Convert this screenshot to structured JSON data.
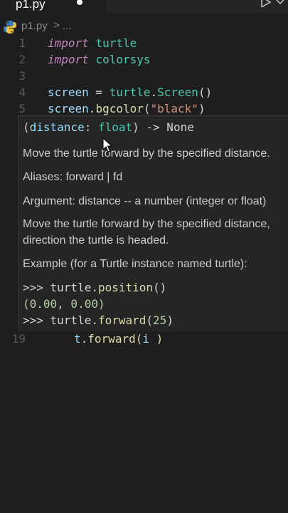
{
  "tab": {
    "filename": "p1.py"
  },
  "breadcrumb": {
    "file": "p1.py",
    "separator": ">",
    "more": "..."
  },
  "lines": [
    {
      "num": "1",
      "t1": "import",
      "t2": " ",
      "t3": "turtle"
    },
    {
      "num": "2",
      "t1": "import",
      "t2": " ",
      "t3": "colorsys"
    },
    {
      "num": "3"
    },
    {
      "num": "4",
      "screen": "screen",
      "eq": " = ",
      "mod": "turtle",
      "dot": ".",
      "fn": "Screen",
      "paren": "()"
    },
    {
      "num": "5",
      "screen": "screen",
      "dot": ".",
      "fn": "bgcolor",
      "open": "(",
      "str": "\"black\"",
      "close": ")"
    }
  ],
  "line19": {
    "num": "19",
    "obj": "t",
    "dot": ".",
    "fn": "forward",
    "open": "(",
    "arg": "i",
    "close": " )"
  },
  "hover": {
    "sig_open": "(",
    "sig_param": "distance",
    "sig_colon": ": ",
    "sig_type": "float",
    "sig_rest": ") -> None",
    "desc1": "Move the turtle forward by the specified distance.",
    "aliases": "Aliases: forward | fd",
    "argument": "Argument: distance -- a number (integer or float)",
    "desc2a": "Move the turtle forward by the specified distance,",
    "desc2b": "direction the turtle is headed.",
    "example": "Example (for a Turtle instance named turtle):",
    "ex1_prompt": ">>> ",
    "ex1_obj": "turtle",
    "ex1_dot": ".",
    "ex1_fn": "position",
    "ex1_paren": "()",
    "ex2": "(0.00, 0.00)",
    "ex3_prompt": ">>> ",
    "ex3_obj": "turtle",
    "ex3_dot": ".",
    "ex3_fn": "forward",
    "ex3_open": "(",
    "ex3_num": "25",
    "ex3_close": ")"
  },
  "colors": {
    "background": "#1e1e1e",
    "hover_background": "#252526",
    "keyword": "#c586c0",
    "function": "#dcdcaa",
    "string": "#ce9178",
    "variable": "#9cdcfe",
    "type": "#4ec9b0"
  }
}
